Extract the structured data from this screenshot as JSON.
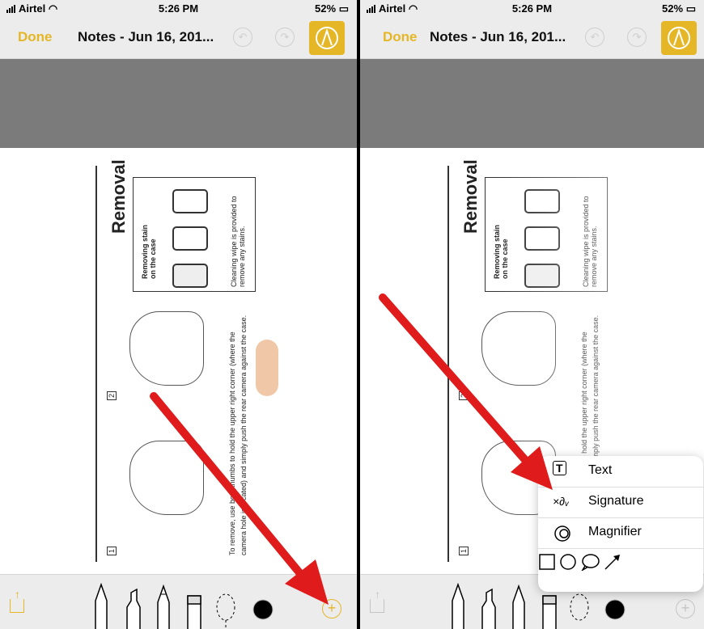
{
  "status": {
    "carrier": "Airtel",
    "time": "5:26 PM",
    "battery": "52%"
  },
  "nav": {
    "done": "Done",
    "title": "Notes - Jun 16, 201..."
  },
  "doc": {
    "heading": "Removal",
    "stain_caption": "Removing stain on the case",
    "wipe_caption": "Cleaning wipe is provided to remove any stains.",
    "instruction_line1": "To remove, use both thumbs to hold the upper right corner (where the",
    "instruction_line2": "camera hole is located) and simply push the rear camera against the case.",
    "step1": "1",
    "step2": "2"
  },
  "menu": {
    "items": [
      {
        "label": "Text",
        "icon": "text-box-icon"
      },
      {
        "label": "Signature",
        "icon": "signature-icon"
      },
      {
        "label": "Magnifier",
        "icon": "magnifier-icon"
      }
    ],
    "shapes": [
      "square-icon",
      "circle-icon",
      "speech-bubble-icon",
      "arrow-icon"
    ]
  },
  "colors": {
    "accent": "#e5b626",
    "arrow": "#e01b1b",
    "grayband": "#7b7b7b"
  }
}
